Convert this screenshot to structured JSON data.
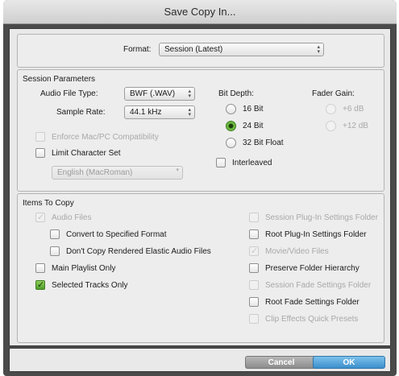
{
  "window": {
    "title": "Save Copy In..."
  },
  "format": {
    "label": "Format:",
    "value": "Session (Latest)"
  },
  "session_parameters": {
    "title": "Session Parameters",
    "audio_file_type": {
      "label": "Audio File Type:",
      "value": "BWF (.WAV)"
    },
    "sample_rate": {
      "label": "Sample Rate:",
      "value": "44.1 kHz"
    },
    "enforce_mac_pc": {
      "label": "Enforce Mac/PC Compatibility",
      "checked": false,
      "enabled": false
    },
    "limit_character_set": {
      "label": "Limit Character Set",
      "checked": false,
      "enabled": true
    },
    "character_set": {
      "value": "English (MacRoman)",
      "enabled": false
    },
    "bit_depth": {
      "label": "Bit Depth:",
      "options": [
        "16 Bit",
        "24 Bit",
        "32 Bit Float"
      ],
      "selected": "24 Bit"
    },
    "fader_gain": {
      "label": "Fader Gain:",
      "options": [
        "+6 dB",
        "+12 dB"
      ],
      "enabled": false
    },
    "interleaved": {
      "label": "Interleaved",
      "checked": false
    }
  },
  "items_to_copy": {
    "title": "Items To Copy",
    "audio_files": {
      "label": "Audio Files",
      "checked": true,
      "enabled": false
    },
    "convert_format": {
      "label": "Convert to Specified Format",
      "checked": false
    },
    "dont_copy_elastic": {
      "label": "Don't Copy Rendered Elastic Audio Files",
      "checked": false
    },
    "main_playlist_only": {
      "label": "Main Playlist Only",
      "checked": false
    },
    "selected_tracks_only": {
      "label": "Selected Tracks Only",
      "checked": true
    },
    "session_plugin_settings": {
      "label": "Session Plug-In Settings Folder",
      "checked": false,
      "enabled": false
    },
    "root_plugin_settings": {
      "label": "Root Plug-In Settings Folder",
      "checked": false
    },
    "movie_video_files": {
      "label": "Movie/Video Files",
      "checked": true,
      "enabled": false
    },
    "preserve_folder_hierarchy": {
      "label": "Preserve Folder Hierarchy",
      "checked": false
    },
    "session_fade_settings": {
      "label": "Session Fade Settings Folder",
      "checked": false,
      "enabled": false
    },
    "root_fade_settings": {
      "label": "Root Fade Settings Folder",
      "checked": false
    },
    "clip_effects_presets": {
      "label": "Clip Effects Quick Presets",
      "checked": false,
      "enabled": false
    }
  },
  "buttons": {
    "cancel": "Cancel",
    "ok": "OK"
  },
  "colors": {
    "check_green": "#5fae35",
    "ok_blue": "#3d8fcb",
    "disabled_text": "#a8a8a8"
  }
}
